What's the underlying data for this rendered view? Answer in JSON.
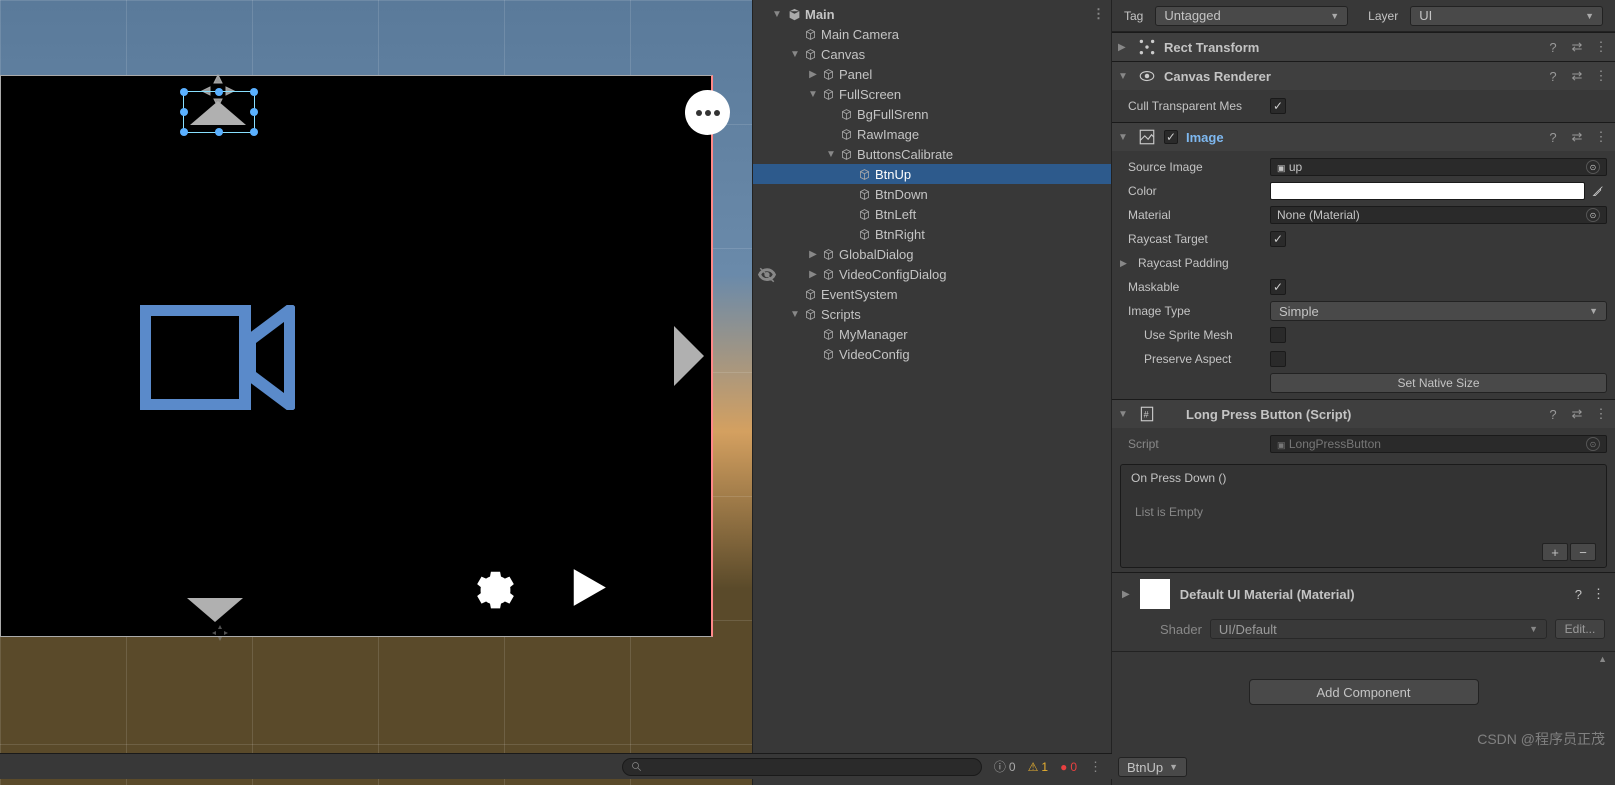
{
  "hierarchy": {
    "root": "Main",
    "items": [
      {
        "name": "Main Camera",
        "indent": 1,
        "expand": "",
        "sel": false
      },
      {
        "name": "Canvas",
        "indent": 1,
        "expand": "▼",
        "sel": false
      },
      {
        "name": "Panel",
        "indent": 2,
        "expand": "▶",
        "sel": false
      },
      {
        "name": "FullScreen",
        "indent": 2,
        "expand": "▼",
        "sel": false
      },
      {
        "name": "BgFullSrenn",
        "indent": 3,
        "expand": "",
        "sel": false
      },
      {
        "name": "RawImage",
        "indent": 3,
        "expand": "",
        "sel": false
      },
      {
        "name": "ButtonsCalibrate",
        "indent": 3,
        "expand": "▼",
        "sel": false
      },
      {
        "name": "BtnUp",
        "indent": 4,
        "expand": "",
        "sel": true
      },
      {
        "name": "BtnDown",
        "indent": 4,
        "expand": "",
        "sel": false
      },
      {
        "name": "BtnLeft",
        "indent": 4,
        "expand": "",
        "sel": false
      },
      {
        "name": "BtnRight",
        "indent": 4,
        "expand": "",
        "sel": false
      },
      {
        "name": "GlobalDialog",
        "indent": 2,
        "expand": "▶",
        "sel": false
      },
      {
        "name": "VideoConfigDialog",
        "indent": 2,
        "expand": "▶",
        "sel": false
      },
      {
        "name": "EventSystem",
        "indent": 1,
        "expand": "",
        "sel": false
      },
      {
        "name": "Scripts",
        "indent": 1,
        "expand": "▼",
        "sel": false
      },
      {
        "name": "MyManager",
        "indent": 2,
        "expand": "",
        "sel": false
      },
      {
        "name": "VideoConfig",
        "indent": 2,
        "expand": "",
        "sel": false
      }
    ]
  },
  "inspector": {
    "tag_label": "Tag",
    "tag_value": "Untagged",
    "layer_label": "Layer",
    "layer_value": "UI",
    "rect": {
      "title": "Rect Transform"
    },
    "canvasRenderer": {
      "title": "Canvas Renderer",
      "cull_label": "Cull Transparent Mes",
      "cull_checked": true
    },
    "image": {
      "title": "Image",
      "src_label": "Source Image",
      "src_value": "up",
      "color_label": "Color",
      "mat_label": "Material",
      "mat_value": "None (Material)",
      "raycast_label": "Raycast Target",
      "raycast_checked": true,
      "padding_label": "Raycast Padding",
      "mask_label": "Maskable",
      "mask_checked": true,
      "type_label": "Image Type",
      "type_value": "Simple",
      "sprite_label": "Use Sprite Mesh",
      "sprite_checked": false,
      "aspect_label": "Preserve Aspect",
      "aspect_checked": false,
      "native_btn": "Set Native Size"
    },
    "lpb": {
      "title": "Long Press Button (Script)",
      "script_label": "Script",
      "script_value": "LongPressButton",
      "event_header": "On Press Down ()",
      "event_empty": "List is Empty"
    },
    "material": {
      "title": "Default UI Material (Material)",
      "shader_label": "Shader",
      "shader_value": "UI/Default",
      "edit": "Edit..."
    },
    "add_component": "Add Component",
    "footer_sel": "BtnUp"
  },
  "status": {
    "info_count": "0",
    "warn_count": "1",
    "err_count": "0"
  },
  "watermark": "CSDN @程序员正茂"
}
